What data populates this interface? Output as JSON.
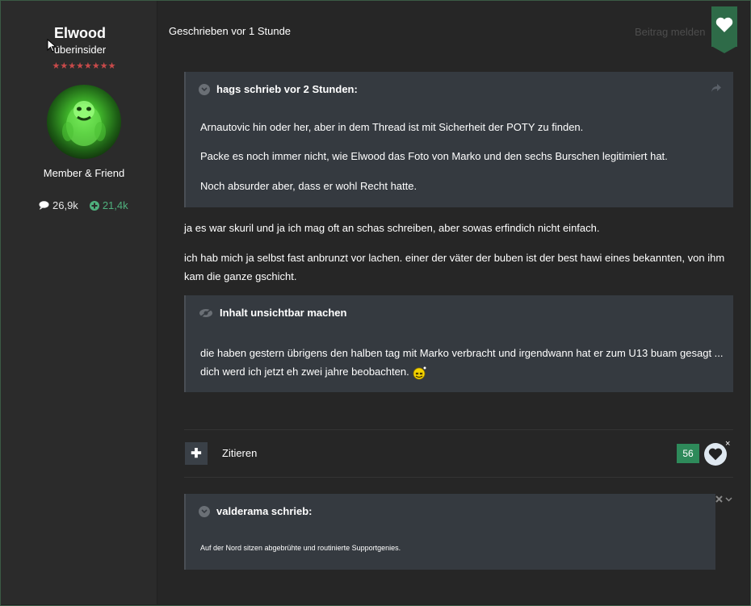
{
  "author": {
    "name": "Elwood",
    "rank": "überinsider",
    "stars": "★★★★★★★★",
    "group": "Member & Friend",
    "posts": "26,9k",
    "reputation": "21,4k"
  },
  "post": {
    "time": "Geschrieben vor 1 Stunde",
    "report": "Beitrag melden",
    "quote1": {
      "header": "hags schrieb vor 2 Stunden:",
      "lines": [
        "Arnautovic hin oder her, aber in dem Thread ist mit Sicherheit der POTY zu finden.",
        "Packe es noch immer nicht, wie Elwood das Foto von Marko und den sechs Burschen legitimiert hat.",
        "Noch absurder aber, dass er wohl Recht hatte."
      ]
    },
    "body": [
      "ja es war skuril und ja ich mag oft an schas schreiben, aber sowas erfindich nicht einfach.",
      "ich hab mich ja selbst fast anbrunzt vor lachen. einer der väter der buben ist der best hawi eines bekannten, von ihm kam die ganze gschicht."
    ],
    "spoiler": {
      "header": "Inhalt unsichtbar machen",
      "text": "die haben gestern übrigens den halben tag mit Marko verbracht und irgendwann hat er zum U13 buam gesagt ... dich werd ich jetzt eh zwei jahre beobachten."
    },
    "actions": {
      "plus": "✚",
      "quote": "Zitieren",
      "likes": "56",
      "remove": "×"
    },
    "quote2": {
      "header": "valderama schrieb:",
      "text": "Auf der Nord sitzen abgebrühte und routinierte Supportgenies."
    }
  },
  "colors": {
    "accent": "#2e6b48",
    "like": "#2e8a5a",
    "reputation": "#4fb07d"
  }
}
